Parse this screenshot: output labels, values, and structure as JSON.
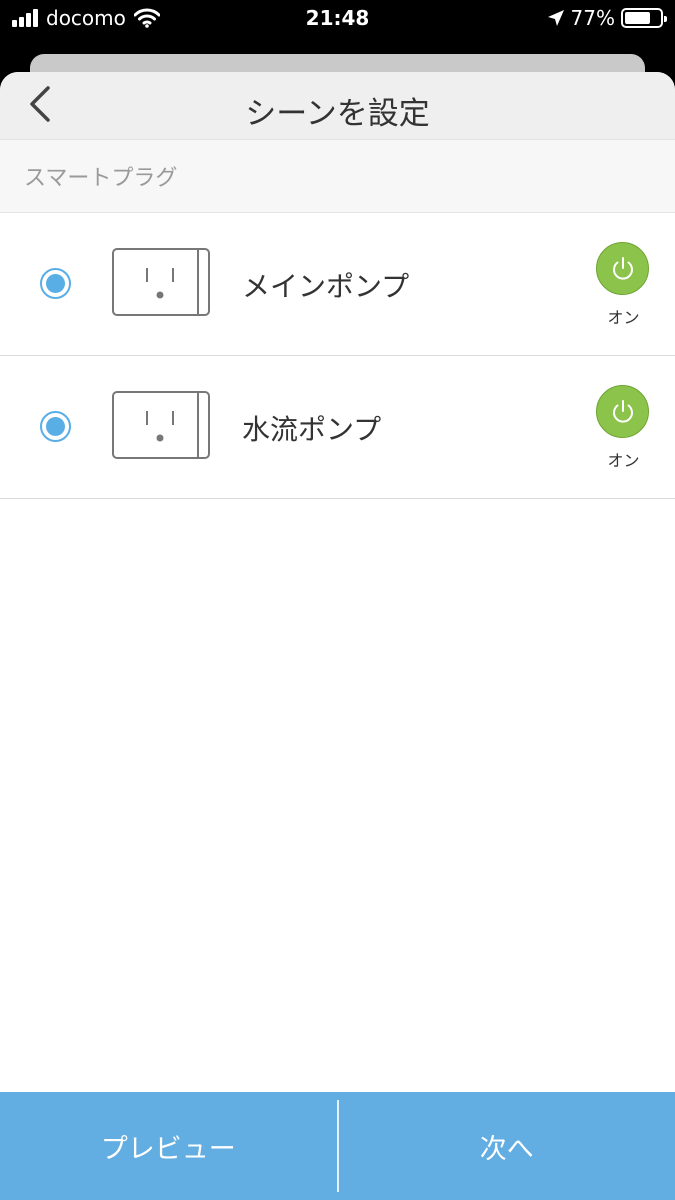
{
  "status_bar": {
    "carrier": "docomo",
    "time": "21:48",
    "battery_percent": "77%",
    "battery_level": 0.77,
    "icons": [
      "signal-icon",
      "wifi-icon",
      "location-arrow-icon",
      "battery-icon"
    ]
  },
  "nav": {
    "back_icon": "chevron-left-icon",
    "title": "シーンを設定"
  },
  "section": {
    "header": "スマートプラグ"
  },
  "devices": [
    {
      "name": "メインポンプ",
      "selected": true,
      "icon": "smart-plug-icon",
      "power_state": "オン",
      "power_icon": "power-icon"
    },
    {
      "name": "水流ポンプ",
      "selected": true,
      "icon": "smart-plug-icon",
      "power_state": "オン",
      "power_icon": "power-icon"
    }
  ],
  "bottom_bar": {
    "preview_label": "プレビュー",
    "next_label": "次へ"
  },
  "colors": {
    "accent_blue": "#62ade2",
    "radio_blue": "#5aaee6",
    "power_green": "#8cc34b",
    "nav_bg": "#efefef",
    "section_bg": "#f7f7f7"
  }
}
